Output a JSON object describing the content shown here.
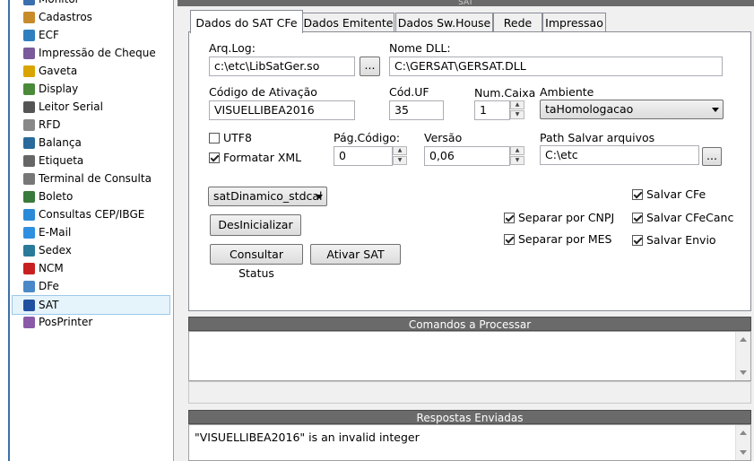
{
  "top_bar": {
    "title": "SAT"
  },
  "tree": {
    "items": [
      {
        "label": "Monitor",
        "icon": "monitor-icon"
      },
      {
        "label": "Cadastros",
        "icon": "cadastros-icon"
      },
      {
        "label": "ECF",
        "icon": "ecf-icon"
      },
      {
        "label": "Impressão de Cheque",
        "icon": "cheque-icon"
      },
      {
        "label": "Gaveta",
        "icon": "gaveta-icon"
      },
      {
        "label": "Display",
        "icon": "display-icon"
      },
      {
        "label": "Leitor Serial",
        "icon": "leitor-serial-icon"
      },
      {
        "label": "RFD",
        "icon": "rfd-icon"
      },
      {
        "label": "Balança",
        "icon": "balanca-icon"
      },
      {
        "label": "Etiqueta",
        "icon": "etiqueta-icon"
      },
      {
        "label": "Terminal de Consulta",
        "icon": "terminal-icon"
      },
      {
        "label": "Boleto",
        "icon": "boleto-icon"
      },
      {
        "label": "Consultas CEP/IBGE",
        "icon": "globe-icon"
      },
      {
        "label": "E-Mail",
        "icon": "email-icon"
      },
      {
        "label": "Sedex",
        "icon": "sedex-icon"
      },
      {
        "label": "NCM",
        "icon": "ncm-icon"
      },
      {
        "label": "DFe",
        "icon": "dfe-icon"
      },
      {
        "label": "SAT",
        "icon": "sat-icon"
      },
      {
        "label": "PosPrinter",
        "icon": "posprinter-icon"
      }
    ]
  },
  "tabs": [
    {
      "label": "Dados do SAT CFe"
    },
    {
      "label": "Dados Emitente"
    },
    {
      "label": "Dados Sw.House"
    },
    {
      "label": "Rede"
    },
    {
      "label": "Impressao"
    }
  ],
  "form": {
    "arq_log_label": "Arq.Log:",
    "arq_log_value": "c:\\etc\\LibSatGer.so",
    "browse_label": "...",
    "nome_dll_label": "Nome DLL:",
    "nome_dll_value": "C:\\GERSAT\\GERSAT.DLL",
    "codigo_ativacao_label": "Código de Ativação",
    "codigo_ativacao_value": "VISUELLIBEA2016",
    "cod_uf_label": "Cód.UF",
    "cod_uf_value": "35",
    "num_caixa_label": "Num.Caixa",
    "num_caixa_value": "1",
    "ambiente_label": "Ambiente",
    "ambiente_value": "taHomologacao",
    "utf8_label": "UTF8",
    "utf8_checked": false,
    "formatar_xml_label": "Formatar XML",
    "formatar_xml_checked": true,
    "pag_codigo_label": "Pág.Código:",
    "pag_codigo_value": "0",
    "versao_label": "Versão",
    "versao_value": "0,06",
    "path_salvar_label": "Path Salvar arquivos",
    "path_salvar_value": "C:\\etc",
    "modelo_value": "satDinamico_stdcal",
    "desinicializar_label": "DesInicializar",
    "consultar_status_label": "Consultar Status",
    "ativar_sat_label": "Ativar SAT",
    "separar_cnpj_label": "Separar por CNPJ",
    "separar_mes_label": "Separar por MES",
    "salvar_cfe_label": "Salvar CFe",
    "salvar_cfecanc_label": "Salvar CFeCanc",
    "salvar_envio_label": "Salvar Envio"
  },
  "comandos": {
    "title": "Comandos a Processar"
  },
  "respostas": {
    "title": "Respostas Enviadas",
    "text": "\"VISUELLIBEA2016\" is an invalid integer"
  }
}
